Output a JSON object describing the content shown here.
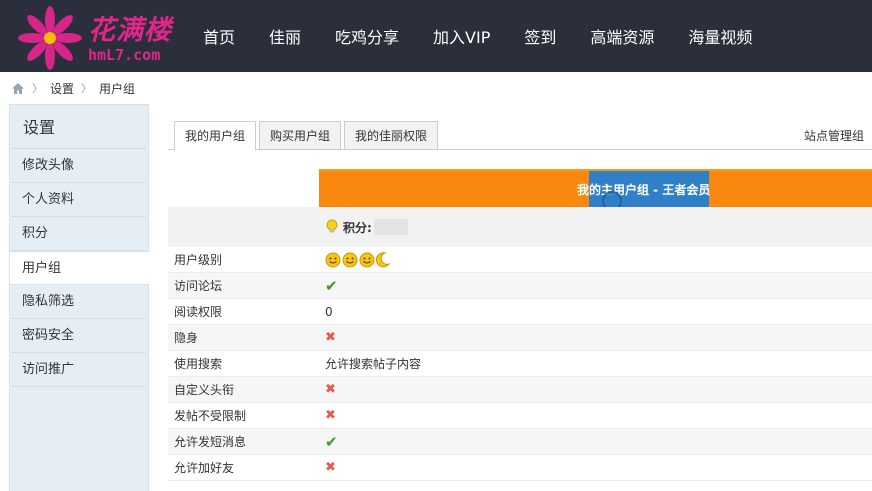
{
  "header": {
    "logo_title": "花满楼",
    "logo_url": "hmL7.com",
    "nav": [
      "首页",
      "佳丽",
      "吃鸡分享",
      "加入VIP",
      "签到",
      "高端资源",
      "海量视频"
    ]
  },
  "breadcrumb": [
    "设置",
    "用户组"
  ],
  "sidebar": {
    "title": "设置",
    "items": [
      "修改头像",
      "个人资料",
      "积分",
      "用户组",
      "隐私筛选",
      "密码安全",
      "访问推广"
    ],
    "active_index": 3
  },
  "tabs": [
    "我的用户组",
    "购买用户组",
    "我的佳丽权限"
  ],
  "site_admin": "站点管理组",
  "group_header": "我的主用户组 - 王者会员",
  "score_label": "积分:",
  "permissions": [
    {
      "label": "用户级别",
      "type": "level",
      "value": ""
    },
    {
      "label": "访问论坛",
      "type": "check",
      "value": "✔"
    },
    {
      "label": "阅读权限",
      "type": "text",
      "value": "0"
    },
    {
      "label": "隐身",
      "type": "cross",
      "value": "✖"
    },
    {
      "label": "使用搜索",
      "type": "text",
      "value": "允许搜索帖子内容"
    },
    {
      "label": "自定义头衔",
      "type": "cross",
      "value": "✖"
    },
    {
      "label": "发帖不受限制",
      "type": "cross",
      "value": "✖"
    },
    {
      "label": "允许发短消息",
      "type": "check",
      "value": "✔"
    },
    {
      "label": "允许加好友",
      "type": "cross",
      "value": "✖"
    }
  ],
  "colors": {
    "header_bg": "#2b2f3b",
    "accent_pink": "#e0268b",
    "orange": "#f7870e",
    "blue": "#2f80c9",
    "sidebar_bg": "#e6eef5"
  }
}
